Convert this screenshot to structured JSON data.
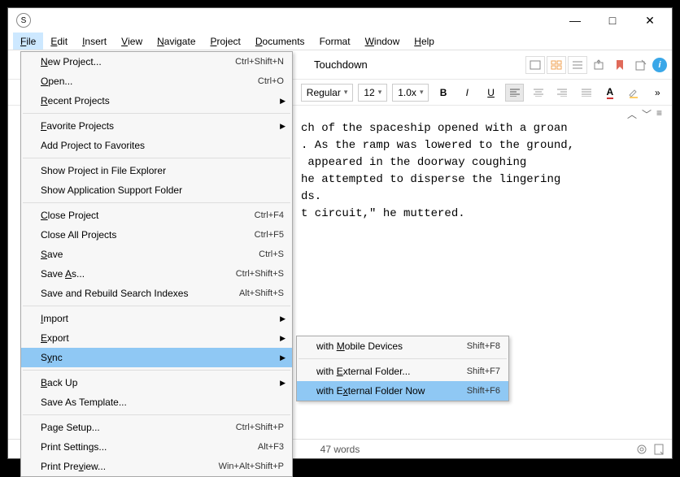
{
  "app_icon": "S",
  "titlebar": {
    "min": "—",
    "max": "□",
    "close": "✕"
  },
  "menubar": [
    "File",
    "Edit",
    "Insert",
    "View",
    "Navigate",
    "Project",
    "Documents",
    "Format",
    "Window",
    "Help"
  ],
  "menubar_ul": [
    "F",
    "E",
    "I",
    "V",
    "N",
    "P",
    "D",
    "",
    "W",
    "H"
  ],
  "tab_title": "Touchdown",
  "toolbar2": {
    "style": "Regular",
    "size": "12",
    "spacing": "1.0x"
  },
  "nav": {
    "up": "︿",
    "down": "﹀",
    "menu": "≡"
  },
  "editor_text": "ch of the spaceship opened with a groan\n. As the ramp was lowered to the ground,\n appeared in the doorway coughing\nhe attempted to disperse the lingering\nds.\nt circuit,\" he muttered.",
  "status": {
    "words": "47 words"
  },
  "file_menu": [
    {
      "label": "New Project...",
      "ul": "N",
      "scut": "Ctrl+Shift+N"
    },
    {
      "label": "Open...",
      "ul": "O",
      "scut": "Ctrl+O"
    },
    {
      "label": "Recent Projects",
      "ul": "R",
      "arrow": true
    },
    {
      "sep": true
    },
    {
      "label": "Favorite Projects",
      "ul": "F",
      "arrow": true
    },
    {
      "label": "Add Project to Favorites"
    },
    {
      "sep": true
    },
    {
      "label": "Show Project in File Explorer"
    },
    {
      "label": "Show Application Support Folder"
    },
    {
      "sep": true
    },
    {
      "label": "Close Project",
      "ul": "C",
      "scut": "Ctrl+F4"
    },
    {
      "label": "Close All Projects",
      "scut": "Ctrl+F5"
    },
    {
      "label": "Save",
      "ul": "S",
      "scut": "Ctrl+S"
    },
    {
      "label": "Save As...",
      "ul": "A",
      "scut": "Ctrl+Shift+S"
    },
    {
      "label": "Save and Rebuild Search Indexes",
      "scut": "Alt+Shift+S"
    },
    {
      "sep": true
    },
    {
      "label": "Import",
      "ul": "I",
      "arrow": true
    },
    {
      "label": "Export",
      "ul": "E",
      "arrow": true
    },
    {
      "label": "Sync",
      "ul": "y",
      "hl": true,
      "arrow": true
    },
    {
      "sep": true
    },
    {
      "label": "Back Up",
      "ul": "B",
      "arrow": true
    },
    {
      "label": "Save As Template..."
    },
    {
      "sep": true
    },
    {
      "label": "Page Setup...",
      "ul": "g",
      "scut": "Ctrl+Shift+P"
    },
    {
      "label": "Print Settings...",
      "scut": "Alt+F3"
    },
    {
      "label": "Print Preview...",
      "ul": "v",
      "scut": "Win+Alt+Shift+P"
    }
  ],
  "sync_menu": [
    {
      "label": "with Mobile Devices",
      "ul": "M",
      "scut": "Shift+F8"
    },
    {
      "sep": true
    },
    {
      "label": "with External Folder...",
      "ul": "E",
      "scut": "Shift+F7"
    },
    {
      "label": "with External Folder Now",
      "ul": "x",
      "hl": true,
      "scut": "Shift+F6"
    }
  ]
}
